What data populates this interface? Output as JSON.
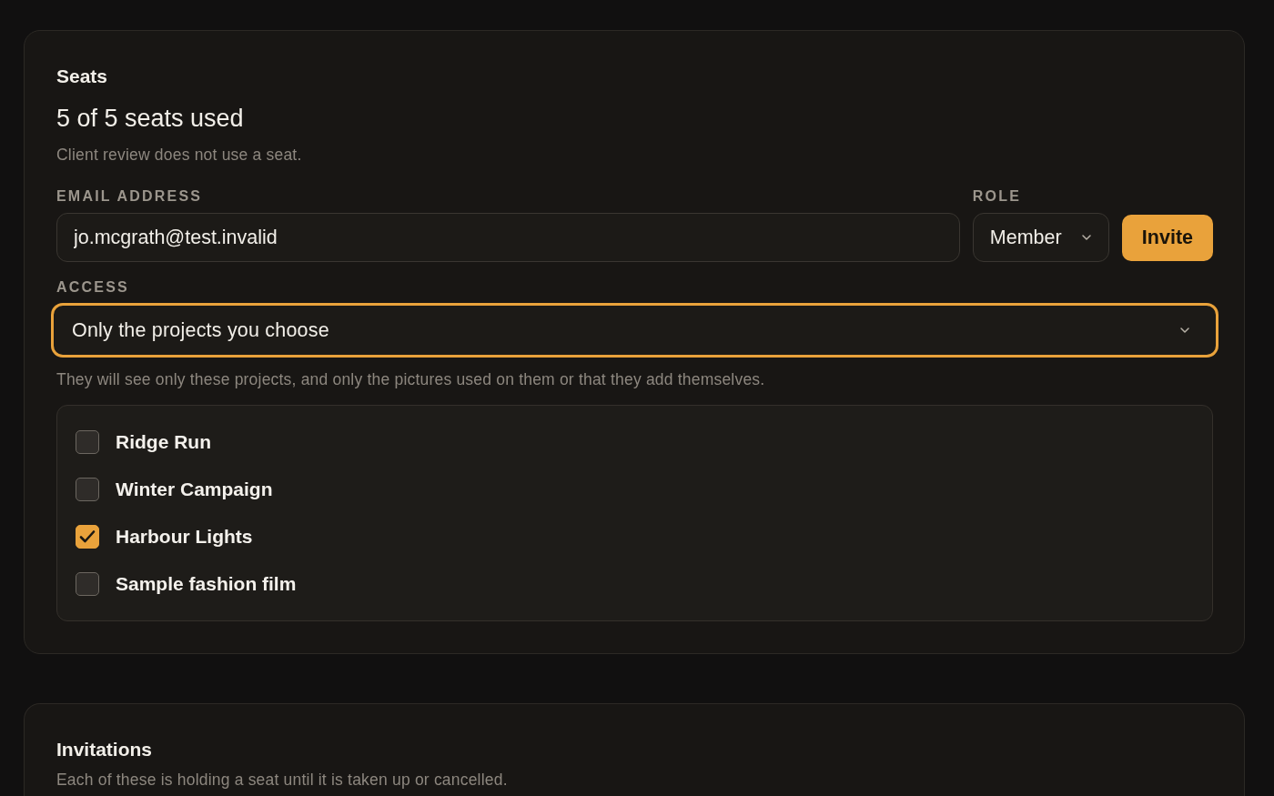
{
  "seats": {
    "title": "Seats",
    "usage": "5 of 5 seats used",
    "note": "Client review does not use a seat.",
    "email": {
      "label": "EMAIL ADDRESS",
      "value": "jo.mcgrath@test.invalid"
    },
    "role": {
      "label": "ROLE",
      "value": "Member"
    },
    "invite_button": "Invite",
    "access": {
      "label": "ACCESS",
      "value": "Only the projects you choose",
      "focused": true,
      "help": "They will see only these projects, and only the pictures used on them or that they add themselves."
    },
    "projects": [
      {
        "name": "Ridge Run",
        "checked": false
      },
      {
        "name": "Winter Campaign",
        "checked": false
      },
      {
        "name": "Harbour Lights",
        "checked": true
      },
      {
        "name": "Sample fashion film",
        "checked": false
      }
    ]
  },
  "invitations": {
    "title": "Invitations",
    "note": "Each of these is holding a seat until it is taken up or cancelled."
  }
}
